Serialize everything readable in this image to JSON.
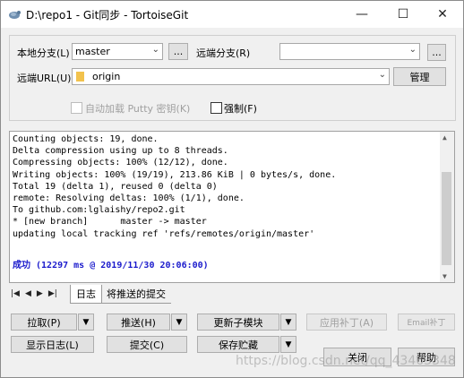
{
  "window": {
    "title": "D:\\repo1 - Git同步 - TortoiseGit",
    "minimize": "—",
    "maximize": "☐",
    "close": "✕"
  },
  "top": {
    "local_branch_label": "本地分支(L)",
    "local_branch_value": "master",
    "local_browse": "...",
    "remote_branch_label": "远端分支(R)",
    "remote_branch_value": "",
    "remote_browse": "...",
    "remote_url_label": "远端URL(U):",
    "remote_url_value": "origin",
    "manage_button": "管理",
    "autoload_putty_label": "自动加载 Putty 密钥(K)",
    "force_label": "强制(F)"
  },
  "log": {
    "lines": [
      "Counting objects: 19, done.",
      "Delta compression using up to 8 threads.",
      "Compressing objects: 100% (12/12), done.",
      "Writing objects: 100% (19/19), 213.86 KiB | 0 bytes/s, done.",
      "Total 19 (delta 1), reused 0 (delta 0)",
      "remote: Resolving deltas: 100% (1/1), done.",
      "To github.com:lglaishy/repo2.git",
      "* [new branch]      master -> master",
      "updating local tracking ref 'refs/remotes/origin/master'"
    ],
    "success": "成功 (12297 ms @ 2019/11/30 20:06:00)"
  },
  "tabs": {
    "log": "日志",
    "commits_to_push": "将推送的提交"
  },
  "buttons": {
    "pull": "拉取(P)",
    "push": "推送(H)",
    "update_submodule": "更新子模块",
    "apply_patch": "应用补丁(A)",
    "email_patch": "Email补丁",
    "show_log": "显示日志(L)",
    "commit": "提交(C)",
    "stash": "保存贮藏",
    "close": "关闭",
    "help": "帮助"
  },
  "watermark": "https://blog.csdn.net/qq_43463348"
}
